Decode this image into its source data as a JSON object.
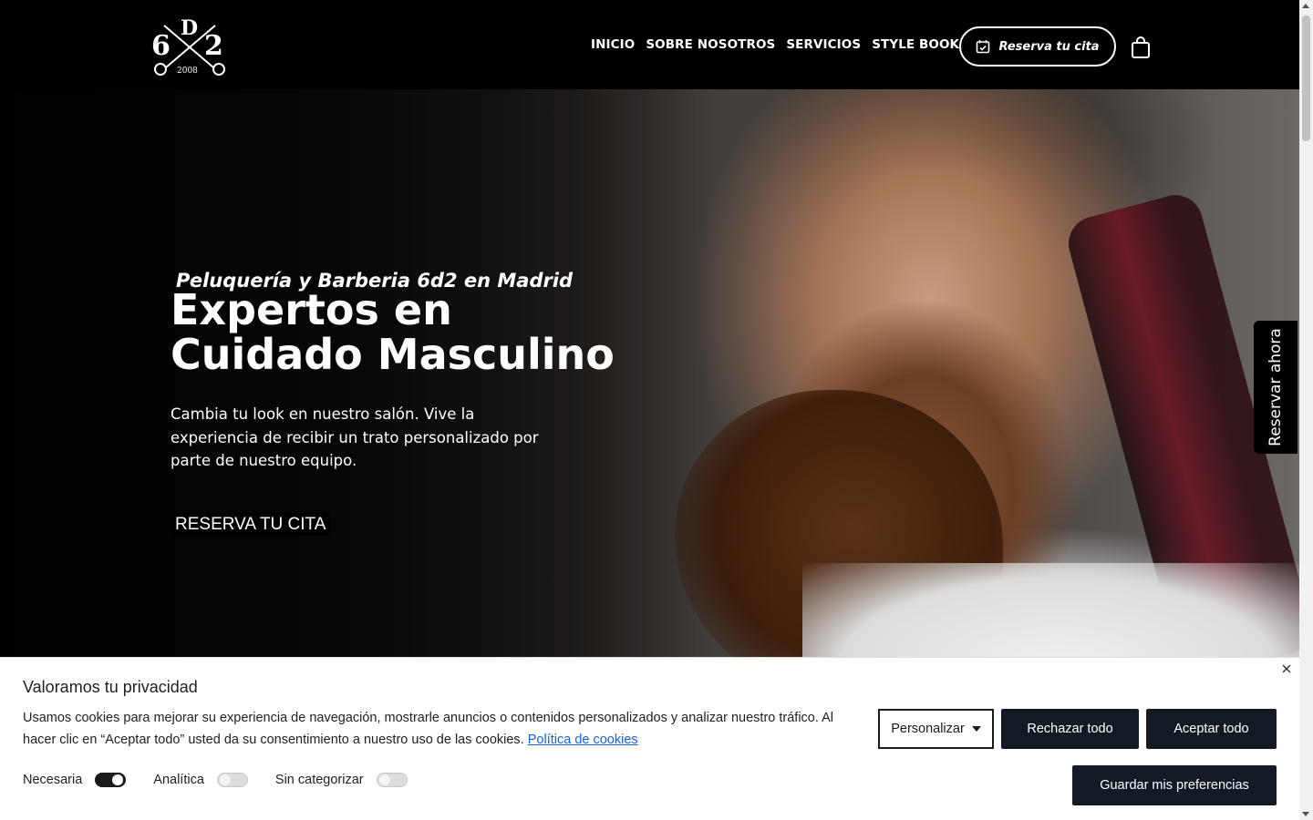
{
  "header": {
    "logo": {
      "letters": [
        "6",
        "D",
        "2"
      ],
      "year": "2008",
      "icon": "scissors-crossed-logo"
    },
    "nav": [
      {
        "label": "INICIO"
      },
      {
        "label": "SOBRE NOSOTROS"
      },
      {
        "label": "SERVICIOS"
      },
      {
        "label": "STYLE BOOK"
      }
    ],
    "book_button": {
      "label": "Reserva tu cita",
      "icon": "calendar-check-icon"
    },
    "cart_icon": "shopping-bag-icon"
  },
  "hero": {
    "subtitle": "Peluquería y Barberia 6d2 en Madrid",
    "title_line1": "Expertos en",
    "title_line2": "Cuidado Masculino",
    "description": "Cambia tu look en nuestro salón. Vive la experiencia de recibir un trato personalizado por parte de nuestro equipo.",
    "cta": "RESERVA TU CITA",
    "image": "man-with-beard-haircut-photo"
  },
  "side_tab": {
    "label": "Reservar ahora"
  },
  "cookie_banner": {
    "title": "Valoramos tu privacidad",
    "text": "Usamos cookies para mejorar su experiencia de navegación, mostrarle anuncios o contenidos personalizados y analizar nuestro tráfico. Al hacer clic en “Aceptar todo” usted da su consentimiento a nuestro uso de las cookies.",
    "policy_link": "Política de cookies",
    "toggles": [
      {
        "label": "Necesaria",
        "on": true
      },
      {
        "label": "Analítica",
        "on": false
      },
      {
        "label": "Sin categorizar",
        "on": false
      }
    ],
    "personalize_label": "Personalizar",
    "reject_label": "Rechazar todo",
    "accept_label": "Aceptar todo",
    "save_label": "Guardar mis preferencias",
    "close_icon": "close-icon"
  },
  "colors": {
    "header_bg": "#000000",
    "button_dark": "#131a26",
    "link": "#1863dc"
  }
}
